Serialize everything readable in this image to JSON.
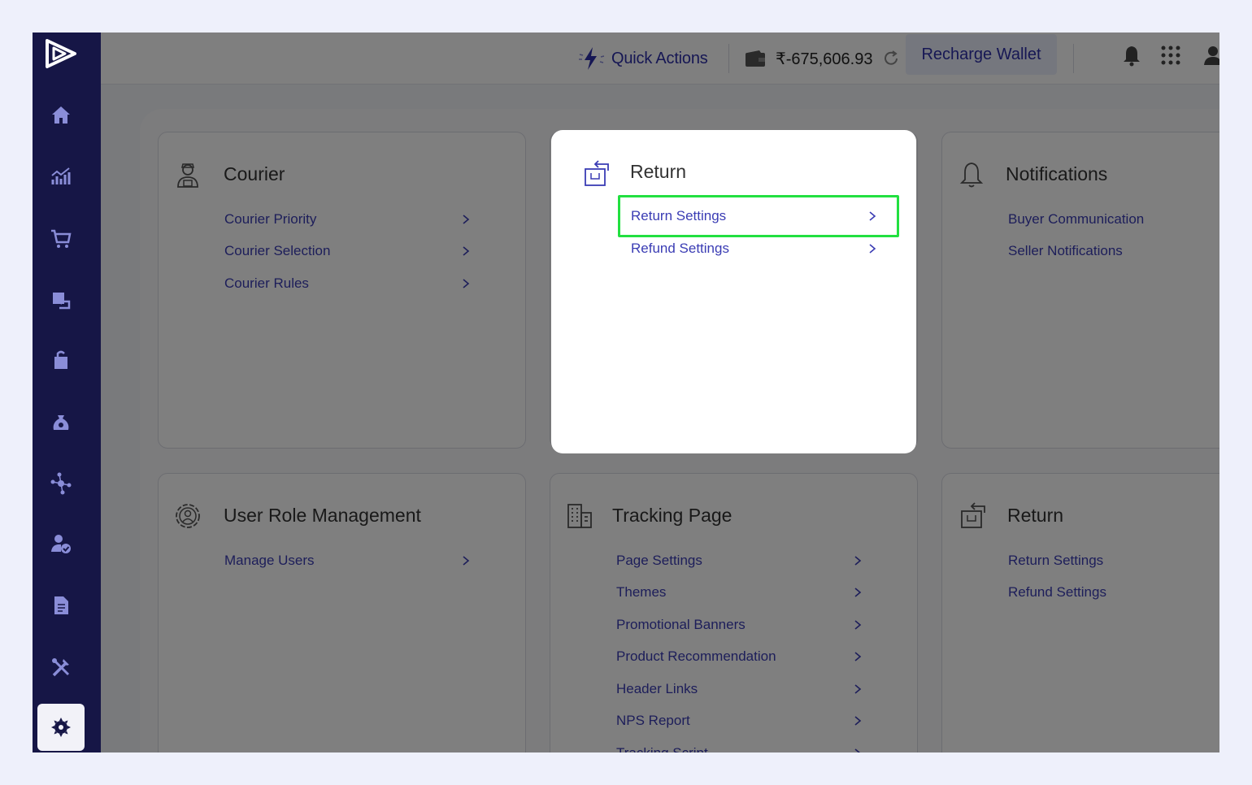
{
  "topbar": {
    "quick_actions": "Quick Actions",
    "wallet_amount": "₹-675,606.93",
    "recharge": "Recharge Wallet"
  },
  "sidebar": {
    "items": [
      "home",
      "analytics",
      "orders",
      "returns",
      "shipments",
      "cod",
      "integrations",
      "users",
      "reports",
      "tools",
      "settings"
    ],
    "active": "settings"
  },
  "cards": {
    "courier": {
      "title": "Courier",
      "links": [
        "Courier Priority",
        "Courier Selection",
        "Courier Rules"
      ]
    },
    "return": {
      "title": "Return",
      "links": [
        "Return Settings",
        "Refund Settings"
      ]
    },
    "notifications": {
      "title": "Notifications",
      "links": [
        "Buyer Communication",
        "Seller Notifications"
      ]
    },
    "user_role": {
      "title": "User Role Management",
      "links": [
        "Manage Users"
      ]
    },
    "tracking": {
      "title": "Tracking Page",
      "links": [
        "Page Settings",
        "Themes",
        "Promotional Banners",
        "Product Recommendation",
        "Header Links",
        "NPS Report",
        "Tracking Script"
      ]
    },
    "return2": {
      "title": "Return",
      "links": [
        "Return Settings",
        "Refund Settings"
      ]
    }
  },
  "colors": {
    "sidebar": "#161646",
    "accent": "#2d2fa8",
    "link": "#3a3cb4",
    "highlight": "#22e040"
  }
}
